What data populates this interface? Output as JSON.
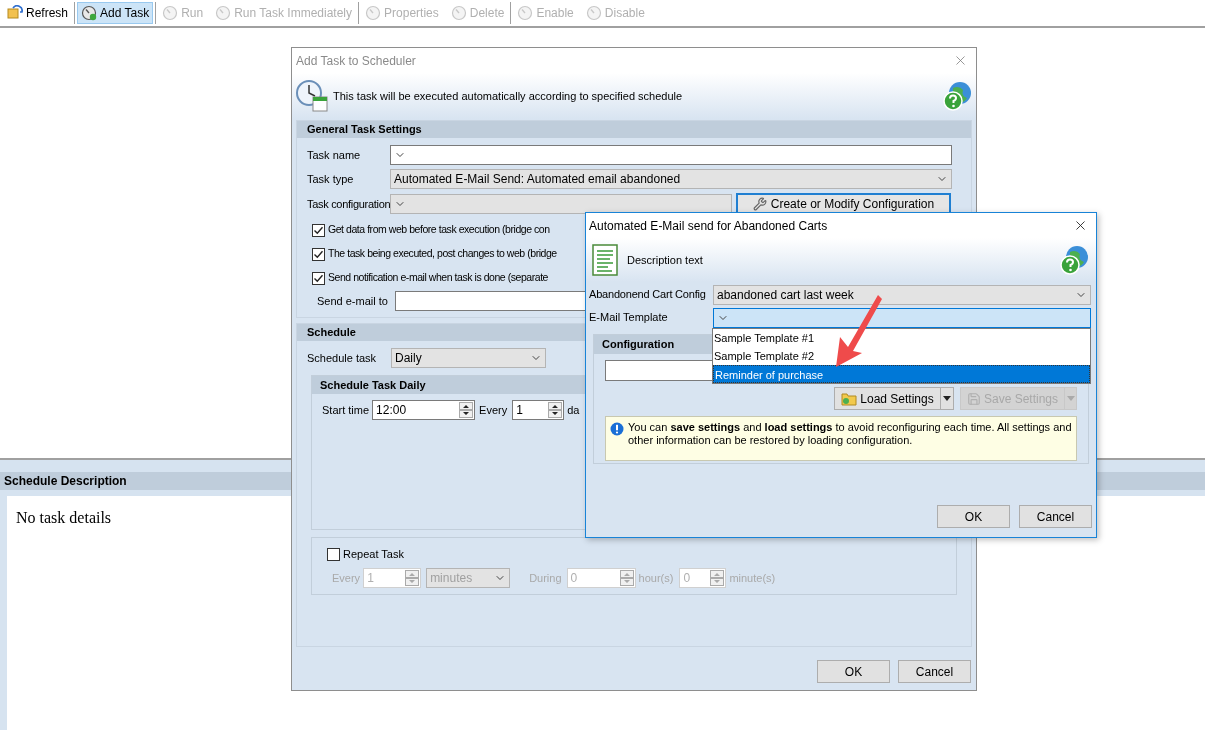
{
  "toolbar_groups": [
    {
      "buttons": [
        {
          "label": "Refresh",
          "kind": "refresh",
          "disabled": false,
          "selected": false
        }
      ]
    },
    {
      "buttons": [
        {
          "label": "Add Task",
          "kind": "add",
          "disabled": false,
          "selected": true
        }
      ]
    },
    {
      "buttons": [
        {
          "label": "Run",
          "kind": "run",
          "disabled": true,
          "selected": false
        },
        {
          "label": "Run Task Immediately",
          "kind": "run",
          "disabled": true,
          "selected": false
        }
      ]
    },
    {
      "buttons": [
        {
          "label": "Properties",
          "kind": "properties",
          "disabled": true,
          "selected": false
        },
        {
          "label": "Delete",
          "kind": "delete",
          "disabled": true,
          "selected": false
        }
      ]
    },
    {
      "buttons": [
        {
          "label": "Enable",
          "kind": "enable",
          "disabled": true,
          "selected": false
        },
        {
          "label": "Disable",
          "kind": "disable",
          "disabled": true,
          "selected": false
        }
      ]
    }
  ],
  "schedule_description": {
    "title": "Schedule Description",
    "text": "No task details"
  },
  "add_task_dialog": {
    "title": "Add Task to Scheduler",
    "header_text": "This task will be executed automatically according to specified schedule",
    "general": {
      "title": "General Task Settings",
      "task_name": {
        "label": "Task name"
      },
      "task_type": {
        "label": "Task type",
        "value": "Automated E-Mail Send: Automated email abandoned"
      },
      "task_configuration": {
        "label": "Task configuration",
        "button": "Create or Modify Configuration"
      },
      "checkboxes": [
        {
          "label": "Get data from web before task execution (bridge con",
          "checked": true
        },
        {
          "label": "The task being executed, post changes to web (bridge",
          "checked": true
        },
        {
          "label": "Send notification e-mail when task is done (separate",
          "checked": true
        }
      ],
      "send_email": {
        "label": "Send e-mail to"
      }
    },
    "schedule": {
      "title": "Schedule",
      "schedule_task": {
        "label": "Schedule task",
        "value": "Daily"
      },
      "daily": {
        "title": "Schedule Task Daily",
        "start_label": "Start time",
        "start_value": "12:00",
        "every_label": "Every",
        "every_value": "1",
        "unit": "da"
      },
      "repeat": {
        "label": "Repeat Task",
        "checked": false,
        "every_label": "Every",
        "every_value": "1",
        "every_unit": "minutes",
        "during_label": "During",
        "hours_value": "0",
        "hours_unit": "hour(s)",
        "minutes_value": "0",
        "minutes_unit": "minute(s)"
      }
    },
    "buttons": [
      "OK",
      "Cancel"
    ]
  },
  "email_dialog": {
    "title": "Automated E-Mail send for Abandoned Carts",
    "description": "Description text",
    "cart_config": {
      "label": "Abandonend Cart Config",
      "value": "abandoned cart last week"
    },
    "email_template": {
      "label": "E-Mail Template",
      "options": [
        {
          "label": "Sample Template #1",
          "selected": false
        },
        {
          "label": "Sample Template #2",
          "selected": false
        },
        {
          "label": "Reminder of purchase",
          "selected": true
        }
      ]
    },
    "configuration": {
      "title": "Configuration",
      "load_button": "Load Settings",
      "save_button": "Save Settings",
      "save_disabled": true,
      "info": "You can **save settings** and **load settings** to avoid reconfiguring each time. All settings and other information can be restored by loading configuration."
    },
    "buttons": [
      "OK",
      "Cancel"
    ]
  }
}
